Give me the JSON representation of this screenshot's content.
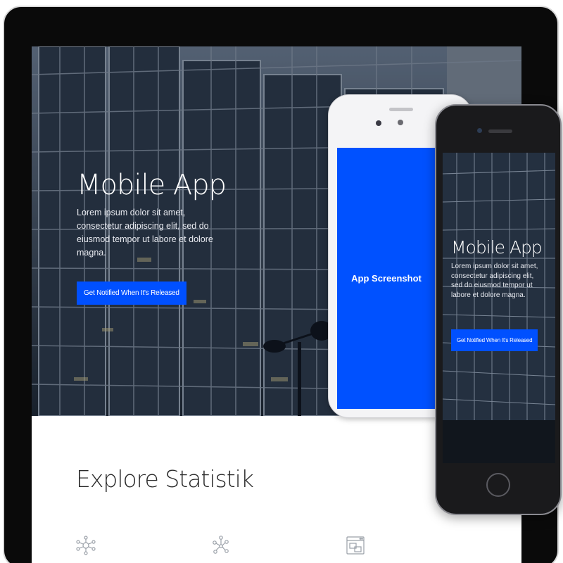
{
  "tablet": {
    "hero": {
      "title": "Mobile App",
      "text": "Lorem ipsum dolor sit amet, consectetur adipiscing elit, sed do eiusmod tempor ut labore et dolore magna.",
      "cta_label": "Get Notified When It's Released"
    },
    "stats": {
      "title": "Explore Statistik",
      "icons": [
        "network-nodes-icon",
        "molecule-icon",
        "browser-chat-icon"
      ]
    }
  },
  "phone_white": {
    "screen_label": "App Screenshot"
  },
  "phone_black": {
    "title": "Mobile App",
    "text": "Lorem ipsum dolor sit amet, consectetur adipiscing elit, sed do eiusmod tempor ut labore et dolore magna.",
    "cta_label": "Get Notified When It's Released"
  },
  "colors": {
    "accent": "#0050ff",
    "device_dark": "#0a0a0a"
  }
}
